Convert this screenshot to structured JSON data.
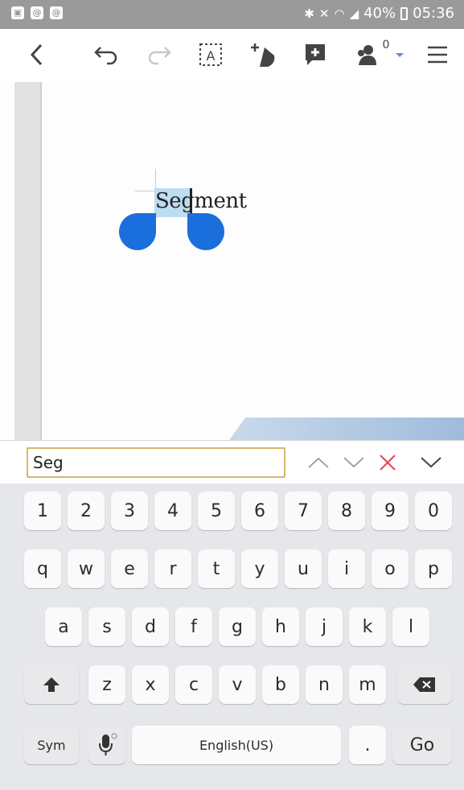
{
  "status_bar": {
    "left_icons": [
      "gallery-icon",
      "at-icon",
      "at-icon"
    ],
    "right_icons": [
      "bluetooth-icon",
      "mute-icon",
      "wifi-icon",
      "signal-icon"
    ],
    "battery": "40%",
    "time": "05:36"
  },
  "toolbar": {
    "buttons": [
      "back-icon",
      "undo-icon",
      "redo-icon",
      "text-box-icon",
      "shapes-icon",
      "insert-comment-icon",
      "collaborators-icon",
      "menu-icon"
    ],
    "collaborator_count": "0"
  },
  "document": {
    "text": "Segment",
    "selected_text": "Seg"
  },
  "find_bar": {
    "query": "Seg"
  },
  "keyboard": {
    "row1": [
      "1",
      "2",
      "3",
      "4",
      "5",
      "6",
      "7",
      "8",
      "9",
      "0"
    ],
    "row2": [
      "q",
      "w",
      "e",
      "r",
      "t",
      "y",
      "u",
      "i",
      "o",
      "p"
    ],
    "row3": [
      "a",
      "s",
      "d",
      "f",
      "g",
      "h",
      "j",
      "k",
      "l"
    ],
    "row4": [
      "z",
      "x",
      "c",
      "v",
      "b",
      "n",
      "m"
    ],
    "sym": "Sym",
    "space": "English(US)",
    "period": ".",
    "go": "Go"
  },
  "colors": {
    "accent": "#1b6fdc",
    "selection": "#bcdcf2",
    "find_border": "#d9b76b",
    "close_red": "#e0474c"
  }
}
